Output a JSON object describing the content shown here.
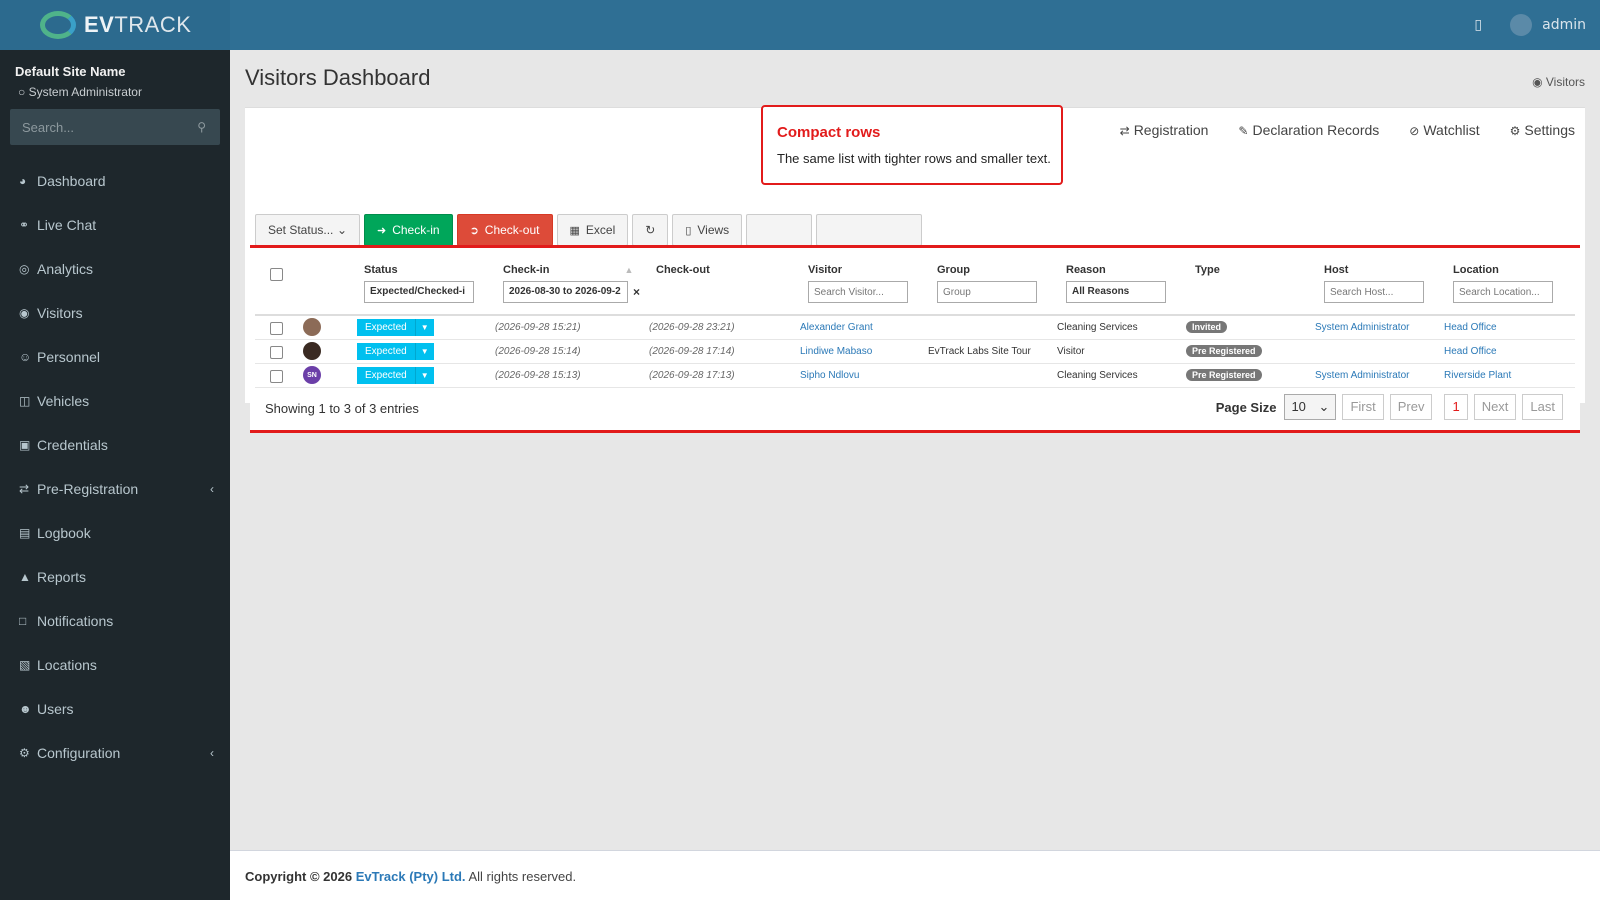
{
  "brand": {
    "name_bold": "EV",
    "name_rest": "TRACK"
  },
  "topbar": {
    "user": "admin",
    "notify_icon": "bookmark-icon"
  },
  "sidebar": {
    "site_name": "Default Site Name",
    "role": "System Administrator",
    "search_placeholder": "Search...",
    "items": [
      {
        "label": "Dashboard",
        "icon": "dashboard-icon"
      },
      {
        "label": "Live Chat",
        "icon": "headset-icon"
      },
      {
        "label": "Analytics",
        "icon": "analytics-icon"
      },
      {
        "label": "Visitors",
        "icon": "eye-icon"
      },
      {
        "label": "Personnel",
        "icon": "personnel-icon"
      },
      {
        "label": "Vehicles",
        "icon": "car-icon"
      },
      {
        "label": "Credentials",
        "icon": "id-card-icon"
      },
      {
        "label": "Pre-Registration",
        "icon": "swap-icon"
      },
      {
        "label": "Logbook",
        "icon": "book-icon"
      },
      {
        "label": "Reports",
        "icon": "chart-icon"
      },
      {
        "label": "Notifications",
        "icon": "chat-icon"
      },
      {
        "label": "Locations",
        "icon": "building-icon"
      },
      {
        "label": "Users",
        "icon": "users-icon"
      },
      {
        "label": "Configuration",
        "icon": "gear-icon"
      }
    ]
  },
  "page": {
    "title": "Visitors Dashboard",
    "breadcrumb": "Visitors"
  },
  "tabs": [
    "Registration",
    "Declaration Records",
    "Watchlist",
    "Settings"
  ],
  "toolbar": {
    "set_status": "Set Status...",
    "checkin": "Check-in",
    "checkout": "Check-out",
    "excel": "Excel",
    "views": "Views"
  },
  "callout": {
    "title": "Compact rows",
    "text": "The same list with tighter rows and smaller text."
  },
  "table": {
    "headers": {
      "status": "Status",
      "checkin": "Check-in",
      "checkout": "Check-out",
      "visitor": "Visitor",
      "group": "Group",
      "reason": "Reason",
      "type": "Type",
      "host": "Host",
      "location": "Location"
    },
    "filters": {
      "status": "Expected/Checked-i",
      "checkin": "2026-08-30 to 2026-09-2",
      "visitor_ph": "Search Visitor...",
      "group_ph": "Group",
      "reason": "All Reasons",
      "host_ph": "Search Host...",
      "location_ph": "Search Location..."
    },
    "rows": [
      {
        "status": "Expected",
        "checkin": "(2026-09-28 15:21)",
        "checkout": "(2026-09-28 23:21)",
        "visitor": "Alexander Grant",
        "group": "",
        "reason": "Cleaning Services",
        "type": "Invited",
        "host": "System Administrator",
        "location": "Head Office",
        "avatar": ""
      },
      {
        "status": "Expected",
        "checkin": "(2026-09-28 15:14)",
        "checkout": "(2026-09-28 17:14)",
        "visitor": "Lindiwe Mabaso",
        "group": "EvTrack Labs Site Tour",
        "reason": "Visitor",
        "type": "Pre Registered",
        "host": "",
        "location": "Head Office",
        "avatar": ""
      },
      {
        "status": "Expected",
        "checkin": "(2026-09-28 15:13)",
        "checkout": "(2026-09-28 17:13)",
        "visitor": "Sipho Ndlovu",
        "group": "",
        "reason": "Cleaning Services",
        "type": "Pre Registered",
        "host": "System Administrator",
        "location": "Riverside Plant",
        "avatar": "SN"
      }
    ],
    "showing": "Showing 1 to 3 of 3 entries",
    "page_size_label": "Page Size",
    "page_size": "10",
    "pager": {
      "first": "First",
      "prev": "Prev",
      "current": "1",
      "next": "Next",
      "last": "Last"
    }
  },
  "footer": {
    "prefix": "Copyright © 2026",
    "company": "EvTrack (Pty) Ltd.",
    "suffix": "All rights reserved."
  },
  "colors": {
    "accent": "#e21b1b",
    "topbar": "#2f6f94",
    "sidebar": "#1e272c",
    "checkin": "#00a65a",
    "checkout": "#dd4b39",
    "expected": "#00c0ef"
  }
}
